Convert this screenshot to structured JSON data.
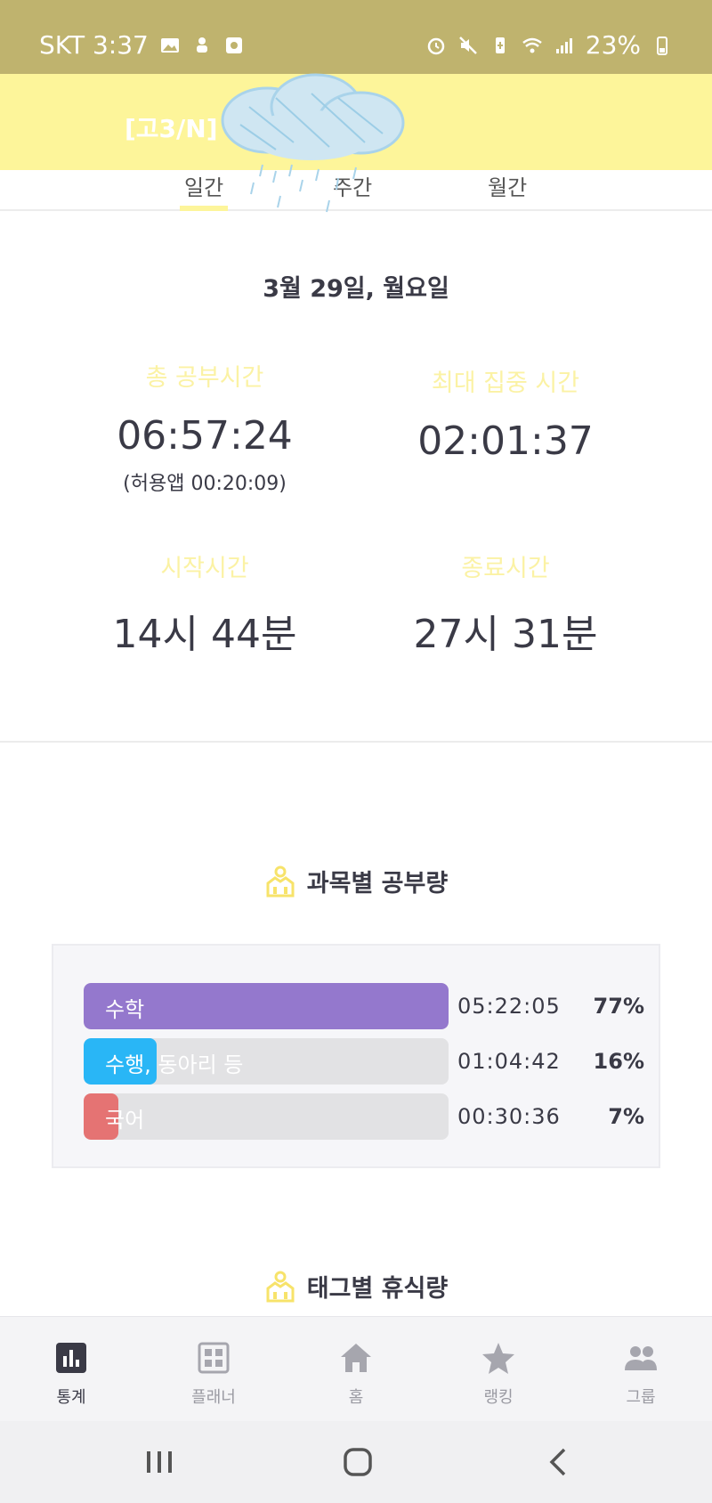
{
  "status_bar": {
    "carrier_time": "SKT 3:37",
    "battery": "23%",
    "left_icons": [
      "gallery-icon",
      "hand-icon",
      "media-icon"
    ],
    "right_icons": [
      "alarm-icon",
      "mute-icon",
      "battery-saver-icon",
      "wifi-icon",
      "signal-icon",
      "battery-icon"
    ]
  },
  "header": {
    "group_title": "[고3/N]",
    "background": "#fdf59a"
  },
  "tabs": [
    {
      "label": "일간",
      "active": true
    },
    {
      "label": "주간",
      "active": false
    },
    {
      "label": "월간",
      "active": false
    }
  ],
  "summary": {
    "date": "3월 29일, 월요일",
    "total_label": "총 공부시간",
    "total_value": "06:57:24",
    "total_sub": "(허용앱  00:20:09)",
    "max_focus_label": "최대 집중 시간",
    "max_focus_value": "02:01:37",
    "start_label": "시작시간",
    "start_value": "14시 44분",
    "end_label": "종료시간",
    "end_value": "27시 31분"
  },
  "subjects_section": {
    "title": "과목별 공부량",
    "items": [
      {
        "name": "수학",
        "time": "05:22:05",
        "percent": "77%",
        "fraction": 1.0,
        "color": "#9478cd"
      },
      {
        "name": "수행, 동아리 등",
        "time": "01:04:42",
        "percent": "16%",
        "fraction": 0.2,
        "color": "#29b6f6"
      },
      {
        "name": "국어",
        "time": "00:30:36",
        "percent": "7%",
        "fraction": 0.095,
        "color": "#e57373"
      }
    ]
  },
  "rest_section": {
    "title": "태그별 휴식량"
  },
  "bottom_nav": [
    {
      "label": "통계",
      "icon": "stats-icon",
      "active": true
    },
    {
      "label": "플래너",
      "icon": "planner-icon",
      "active": false
    },
    {
      "label": "홈",
      "icon": "home-icon",
      "active": false
    },
    {
      "label": "랭킹",
      "icon": "star-icon",
      "active": false
    },
    {
      "label": "그룹",
      "icon": "group-icon",
      "active": false
    }
  ],
  "colors": {
    "accent_yellow": "#fdf59a",
    "label_yellow": "#fbf2a4",
    "status_bar": "#bfb36e",
    "text_dark": "#3a3a46"
  }
}
